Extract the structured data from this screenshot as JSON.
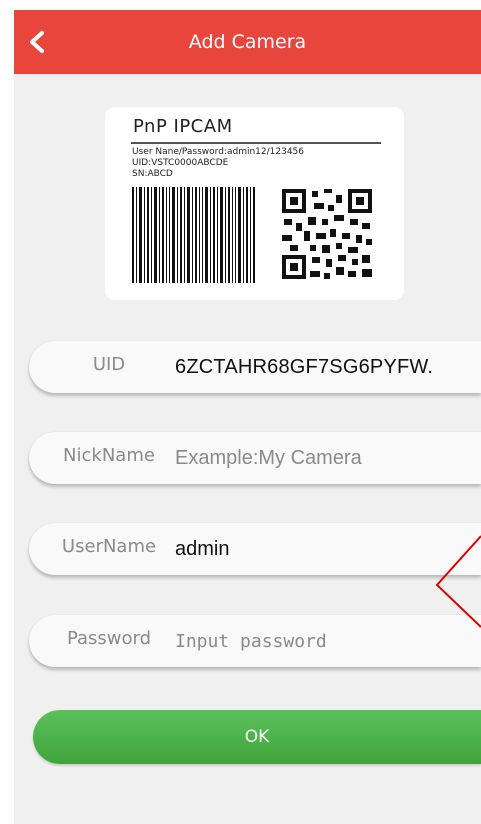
{
  "header": {
    "title": "Add Camera",
    "back_icon": "chevron-left-icon",
    "color": "#e8453c"
  },
  "label": {
    "brand": "PnP IPCAM",
    "lines": [
      "User Nane/Password:admin12/123456",
      "UID:VSTC0000ABCDE",
      "SN:ABCD"
    ],
    "barcode_icon": "barcode-icon",
    "qrcode_icon": "qr-code-icon"
  },
  "form": {
    "uid": {
      "label": "UID",
      "value": "6ZCTAHR68GF7SG6PYFW."
    },
    "nickname": {
      "label": "NickName",
      "placeholder": "Example:My Camera"
    },
    "username": {
      "label": "UserName",
      "value": "admin"
    },
    "password": {
      "label": "Password",
      "placeholder": "Input password"
    }
  },
  "ok_button": {
    "label": "OK",
    "color": "#4db34a"
  },
  "annotation_color": "#e00000"
}
